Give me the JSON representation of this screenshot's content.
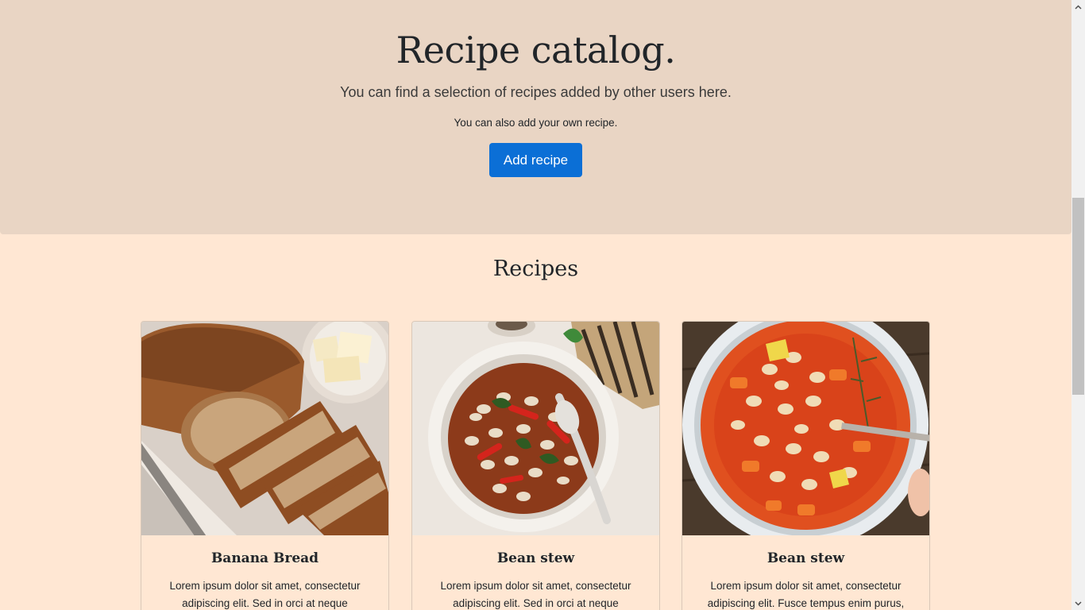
{
  "hero": {
    "title": "Recipe catalog.",
    "lead": "You can find a selection of recipes added by other users here.",
    "note": "You can also add your own recipe.",
    "add_button": "Add recipe"
  },
  "recipes": {
    "heading": "Recipes",
    "cards": [
      {
        "title": "Banana Bread",
        "text": "Lorem ipsum dolor sit amet, consectetur adipiscing elit. Sed in orci at neque",
        "image": "banana-bread-photo"
      },
      {
        "title": "Bean stew",
        "text": "Lorem ipsum dolor sit amet, consectetur adipiscing elit. Sed in orci at neque",
        "image": "bean-stew-bowl-photo"
      },
      {
        "title": "Bean stew",
        "text": "Lorem ipsum dolor sit amet, consectetur adipiscing elit. Fusce tempus enim purus,",
        "image": "bean-soup-photo"
      }
    ]
  },
  "colors": {
    "hero_background": "#e9d5c4",
    "page_background": "#ffe7d3",
    "accent": "#0b6fd6"
  }
}
